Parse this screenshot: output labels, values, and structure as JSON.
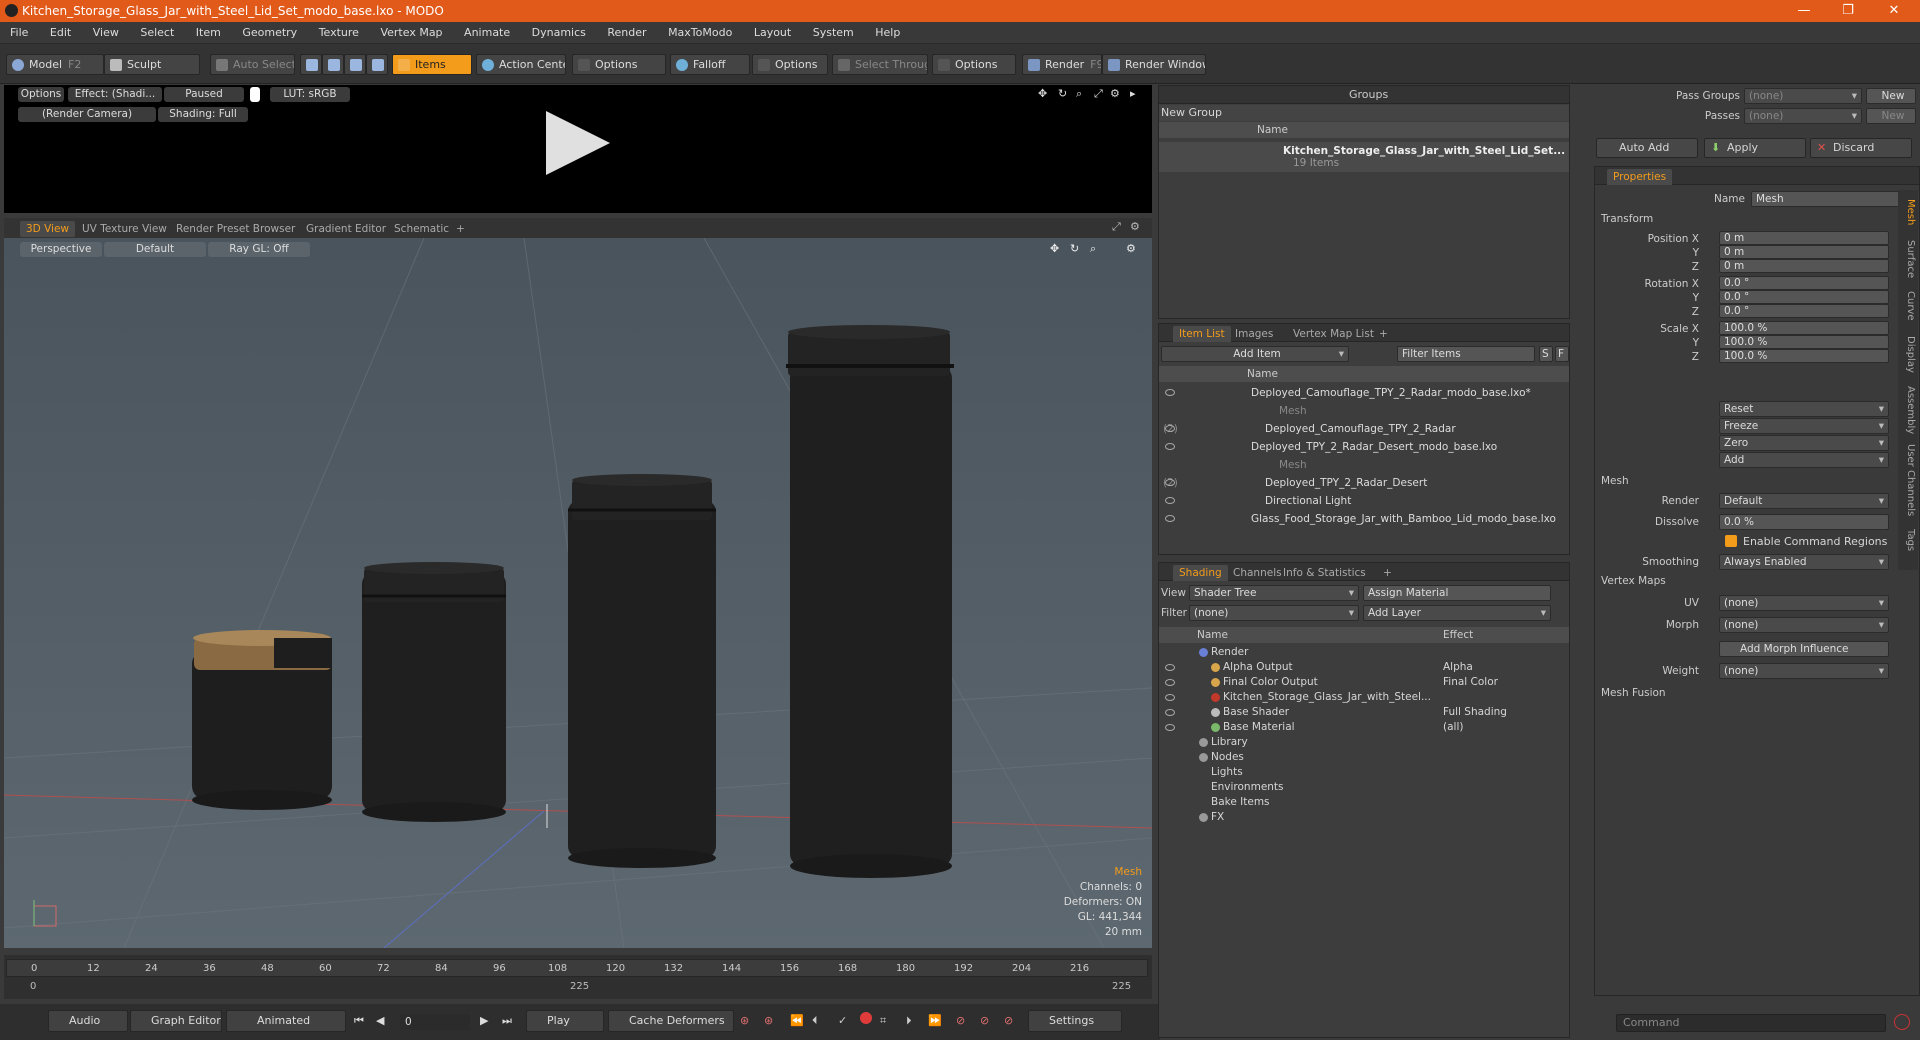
{
  "window": {
    "title": "Kitchen_Storage_Glass_Jar_with_Steel_Lid_Set_modo_base.lxo - MODO",
    "controls": [
      "—",
      "❐",
      "✕"
    ]
  },
  "menu": [
    "File",
    "Edit",
    "View",
    "Select",
    "Item",
    "Geometry",
    "Texture",
    "Vertex Map",
    "Animate",
    "Dynamics",
    "Render",
    "MaxToModo",
    "Layout",
    "System",
    "Help"
  ],
  "toolbar": {
    "model": "Model",
    "model_key": "F2",
    "sculpt": "Sculpt",
    "auto_select": "Auto Select",
    "items": "Items",
    "action_center": "Action Center",
    "options1": "Options",
    "falloff": "Falloff",
    "options2": "Options",
    "select_through": "Select Through",
    "options3": "Options",
    "render": "Render",
    "render_key": "F9",
    "render_window": "Render Window"
  },
  "preview": {
    "options": "Options",
    "effect": "Effect: (Shadi...",
    "paused": "Paused",
    "lut": "LUT: sRGB",
    "camera": "(Render Camera)",
    "shading": "Shading: Full"
  },
  "view_tabs": [
    "3D View",
    "UV Texture View",
    "Render Preset Browser",
    "Gradient Editor",
    "Schematic",
    "+"
  ],
  "viewport": {
    "projection": "Perspective",
    "style": "Default",
    "raygl": "Ray GL: Off",
    "hud": {
      "item": "Mesh",
      "channels": "Channels: 0",
      "deformers": "Deformers: ON",
      "gl": "GL: 441,344",
      "unit": "20 mm"
    }
  },
  "timeline": {
    "ticks": [
      "0",
      "12",
      "24",
      "36",
      "48",
      "60",
      "72",
      "84",
      "96",
      "108",
      "120",
      "132",
      "144",
      "156",
      "168",
      "180",
      "192",
      "204",
      "216"
    ],
    "sub0": "0",
    "sub_mid": "225",
    "sub_end": "225"
  },
  "bottombar": {
    "audio": "Audio",
    "graph_editor": "Graph Editor",
    "animated": "Animated",
    "frame": "0",
    "play": "Play",
    "cache": "Cache Deformers",
    "settings": "Settings"
  },
  "groups": {
    "title": "Groups",
    "new_group": "New Group",
    "col_name": "Name",
    "item": "Kitchen_Storage_Glass_Jar_with_Steel_Lid_Set...",
    "count": "19 Items"
  },
  "itemlist": {
    "tabs": [
      "Item List",
      "Images",
      "Vertex Map List",
      "+"
    ],
    "add_item": "Add Item",
    "filter": "Filter Items",
    "s": "S",
    "f": "F",
    "col_name": "Name",
    "rows": [
      {
        "text": "Deployed_Camouflage_TPY_2_Radar_modo_base.lxo*",
        "indent": 0,
        "dim": false
      },
      {
        "text": "Mesh",
        "indent": 2,
        "dim": true
      },
      {
        "text": "Deployed_Camouflage_TPY_2_Radar",
        "extra": "(2)",
        "indent": 1,
        "dim": false
      },
      {
        "text": "Deployed_TPY_2_Radar_Desert_modo_base.lxo",
        "indent": 0,
        "dim": false
      },
      {
        "text": "Mesh",
        "indent": 2,
        "dim": true
      },
      {
        "text": "Deployed_TPY_2_Radar_Desert",
        "extra": "(2)",
        "indent": 1,
        "dim": false
      },
      {
        "text": "Directional Light",
        "indent": 1,
        "dim": false
      },
      {
        "text": "Glass_Food_Storage_Jar_with_Bamboo_Lid_modo_base.lxo",
        "indent": 0,
        "dim": false
      }
    ]
  },
  "shading": {
    "tabs": [
      "Shading",
      "Channels",
      "Info & Statistics",
      "+"
    ],
    "view_label": "View",
    "view_value": "Shader Tree",
    "assign": "Assign Material",
    "filter_label": "Filter",
    "filter_value": "(none)",
    "add_layer": "Add Layer",
    "col_name": "Name",
    "col_effect": "Effect",
    "rows": [
      {
        "name": "Render",
        "effect": "",
        "indent": 0,
        "icon": "#6a7fd6"
      },
      {
        "name": "Alpha Output",
        "effect": "Alpha",
        "indent": 1,
        "icon": "#d9a54a"
      },
      {
        "name": "Final Color Output",
        "effect": "Final Color",
        "indent": 1,
        "icon": "#d9a54a"
      },
      {
        "name": "Kitchen_Storage_Glass_Jar_with_Steel...",
        "effect": "",
        "indent": 1,
        "icon": "#c0392b"
      },
      {
        "name": "Base Shader",
        "effect": "Full Shading",
        "indent": 1,
        "icon": "#bbbbbb"
      },
      {
        "name": "Base Material",
        "effect": "(all)",
        "indent": 1,
        "icon": "#7ab86a"
      },
      {
        "name": "Library",
        "effect": "",
        "indent": 0,
        "icon": "#999999"
      },
      {
        "name": "Nodes",
        "effect": "",
        "indent": 0,
        "icon": "#999999"
      },
      {
        "name": "Lights",
        "effect": "",
        "indent": 0,
        "icon": ""
      },
      {
        "name": "Environments",
        "effect": "",
        "indent": 0,
        "icon": ""
      },
      {
        "name": "Bake Items",
        "effect": "",
        "indent": 0,
        "icon": ""
      },
      {
        "name": "FX",
        "effect": "",
        "indent": 0,
        "icon": "#999999"
      }
    ]
  },
  "passes": {
    "pass_groups_label": "Pass Groups",
    "pass_groups_value": "(none)",
    "passes_label": "Passes",
    "passes_value": "(none)",
    "new": "New",
    "new2": "New"
  },
  "actions": {
    "auto_add": "Auto Add",
    "apply": "Apply",
    "discard": "Discard"
  },
  "properties": {
    "tab": "Properties",
    "name_label": "Name",
    "name_value": "Mesh",
    "transform": "Transform",
    "fields": [
      {
        "label": "Position X",
        "value": "0 m"
      },
      {
        "label": "Y",
        "value": "0 m"
      },
      {
        "label": "Z",
        "value": "0 m"
      },
      {
        "label": "Rotation X",
        "value": "0.0 °"
      },
      {
        "label": "Y",
        "value": "0.0 °"
      },
      {
        "label": "Z",
        "value": "0.0 °"
      },
      {
        "label": "Scale X",
        "value": "100.0 %"
      },
      {
        "label": "Y",
        "value": "100.0 %"
      },
      {
        "label": "Z",
        "value": "100.0 %"
      }
    ],
    "reset": "Reset",
    "freeze": "Freeze",
    "zero": "Zero",
    "add": "Add",
    "mesh": "Mesh",
    "render_label": "Render",
    "render_value": "Default",
    "dissolve_label": "Dissolve",
    "dissolve_value": "0.0 %",
    "enable_cmd": "Enable Command Regions",
    "smoothing_label": "Smoothing",
    "smoothing_value": "Always Enabled",
    "vertex_maps": "Vertex Maps",
    "uv_label": "UV",
    "uv_value": "(none)",
    "morph_label": "Morph",
    "morph_value": "(none)",
    "add_morph": "Add Morph Influence",
    "weight_label": "Weight",
    "weight_value": "(none)",
    "mesh_fusion": "Mesh Fusion",
    "side_tabs": [
      "Mesh",
      "Surface",
      "Curve",
      "Display",
      "Assembly",
      "User Channels",
      "Tags"
    ]
  },
  "command": {
    "placeholder": "Command"
  }
}
